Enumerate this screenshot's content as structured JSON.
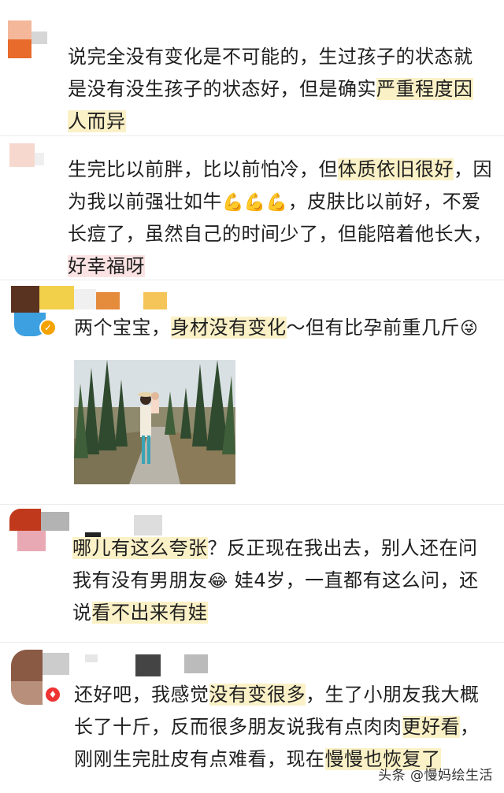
{
  "comments": [
    {
      "lines": [
        "说完全没有变化是不可能的，生过孩子的状态就",
        "是没有没生孩子的状态好，但是确实",
        "严重程度因",
        "人而异"
      ],
      "avatar_colors": [
        "#e86b2c",
        "#f4b79a",
        "#c6c6c6"
      ]
    },
    {
      "lines": [
        "生完比以前胖，比以前怕冷，但",
        "体质依旧很好",
        "，因",
        "为我以前强壮如牛",
        "💪💪💪",
        "，皮肤比以前好，不爱",
        "长痘了，虽然自己的时间少了，但能陪着他长大，",
        "好幸福呀"
      ],
      "avatar_colors": [
        "#f6d8cf",
        "#efefef"
      ]
    },
    {
      "lines": [
        "两个宝宝，",
        "身材没有变化",
        "～但有比孕前重几斤",
        "😜"
      ],
      "avatar_colors": [
        "#5a3320",
        "#f2d04a",
        "#f0f0f0",
        "#e58b3c",
        "#3da0e0",
        "#f5c55a"
      ]
    },
    {
      "lines": [
        "哪儿有这么夸张",
        "？反正现在我出去，别人还在问",
        "我有没有男朋友",
        "😂",
        " 娃4岁，一直都有这么问，还",
        "说",
        "看不出来有娃"
      ],
      "avatar_colors": [
        "#c0391c",
        "#b3b3b3",
        "#e9a9b4",
        "#222222",
        "#dddddd"
      ]
    },
    {
      "lines": [
        "还好吧，我感觉",
        "没有变很多",
        "，生了小朋友我大概",
        "长了十斤，反而很多朋友说我有点肉肉",
        "更好看",
        "，",
        "刚刚生完肚皮有点难看，现在",
        "慢慢也恢复了"
      ],
      "avatar_colors": [
        "#8a5a44",
        "#cccccc",
        "#444444",
        "#bbbbbb"
      ]
    }
  ],
  "watermark": "头条 @慢妈绘生活"
}
